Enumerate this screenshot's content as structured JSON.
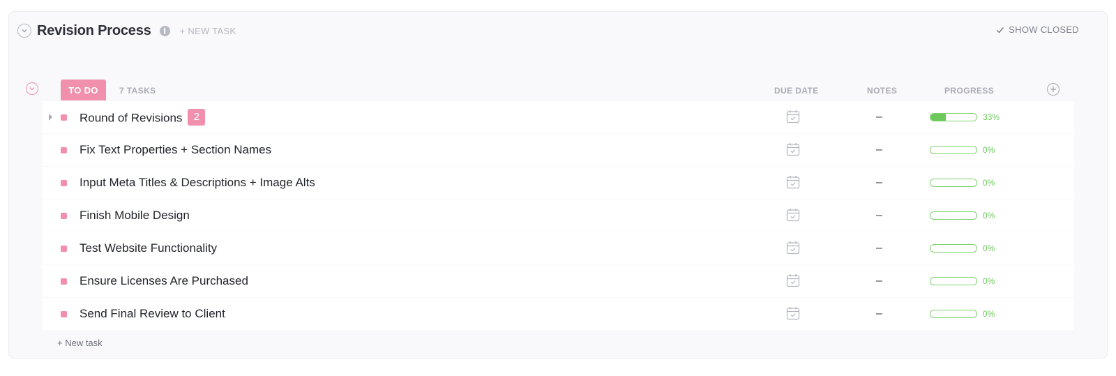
{
  "list": {
    "title": "Revision Process",
    "new_task_label": "+ NEW TASK",
    "show_closed_label": "SHOW CLOSED"
  },
  "group": {
    "status": "TO DO",
    "task_count": "7 TASKS",
    "status_color": "#f090ac",
    "columns": {
      "due_date": "DUE DATE",
      "notes": "NOTES",
      "progress": "PROGRESS"
    }
  },
  "tasks": [
    {
      "name": "Round of Revisions",
      "subtasks": "2",
      "notes": "–",
      "progress_label": "33%",
      "progress": 0.33
    },
    {
      "name": "Fix Text Properties + Section Names",
      "notes": "–",
      "progress_label": "0%",
      "progress": 0
    },
    {
      "name": "Input Meta Titles & Descriptions + Image Alts",
      "notes": "–",
      "progress_label": "0%",
      "progress": 0
    },
    {
      "name": "Finish Mobile Design",
      "notes": "–",
      "progress_label": "0%",
      "progress": 0
    },
    {
      "name": "Test Website Functionality",
      "notes": "–",
      "progress_label": "0%",
      "progress": 0
    },
    {
      "name": "Ensure Licenses Are Purchased",
      "notes": "–",
      "progress_label": "0%",
      "progress": 0
    },
    {
      "name": "Send Final Review to Client",
      "notes": "–",
      "progress_label": "0%",
      "progress": 0
    }
  ],
  "footer": {
    "new_task_label": "+ New task"
  },
  "colors": {
    "accent_pink": "#f090ac",
    "progress_green": "#6cc85a"
  }
}
